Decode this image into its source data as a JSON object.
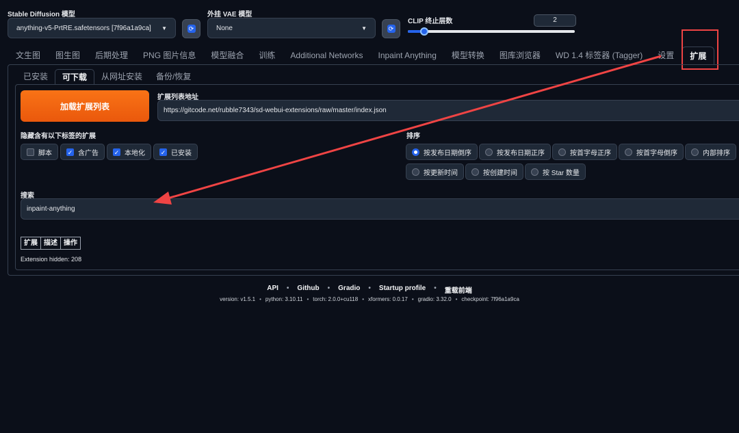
{
  "top": {
    "sd_model_label": "Stable Diffusion 模型",
    "sd_model_value": "anything-v5-PrtRE.safetensors [7f96a1a9ca]",
    "vae_label": "外挂 VAE 模型",
    "vae_value": "None",
    "clip_label": "CLIP 终止层数",
    "clip_value": "2",
    "clip_fraction": 0.1
  },
  "tabs": [
    {
      "label": "文生图"
    },
    {
      "label": "图生图"
    },
    {
      "label": "后期处理"
    },
    {
      "label": "PNG 图片信息"
    },
    {
      "label": "模型融合"
    },
    {
      "label": "训练"
    },
    {
      "label": "Additional Networks"
    },
    {
      "label": "Inpaint Anything"
    },
    {
      "label": "模型转换"
    },
    {
      "label": "图库浏览器"
    },
    {
      "label": "WD 1.4 标签器 (Tagger)"
    },
    {
      "label": "设置"
    },
    {
      "label": "扩展"
    }
  ],
  "subtabs": [
    {
      "label": "已安装"
    },
    {
      "label": "可下载"
    },
    {
      "label": "从网址安装"
    },
    {
      "label": "备份/恢复"
    }
  ],
  "available": {
    "load_button": "加载扩展列表",
    "url_label": "扩展列表地址",
    "url_value": "https://gitcode.net/rubble7343/sd-webui-extensions/raw/master/index.json",
    "hide_label": "隐藏含有以下标签的扩展",
    "hide_options": [
      {
        "label": "脚本",
        "checked": false
      },
      {
        "label": "含广告",
        "checked": true
      },
      {
        "label": "本地化",
        "checked": true
      },
      {
        "label": "已安装",
        "checked": true
      }
    ],
    "sort_label": "排序",
    "sort_options": [
      {
        "label": "按发布日期倒序",
        "selected": true
      },
      {
        "label": "按发布日期正序",
        "selected": false
      },
      {
        "label": "按首字母正序",
        "selected": false
      },
      {
        "label": "按首字母倒序",
        "selected": false
      },
      {
        "label": "内部排序",
        "selected": false
      },
      {
        "label": "按更新时间",
        "selected": false
      },
      {
        "label": "按创建时间",
        "selected": false
      },
      {
        "label": "按 Star 数量",
        "selected": false
      }
    ],
    "search_label": "搜索",
    "search_value": "inpaint-anything",
    "table_headers": [
      "扩展",
      "描述",
      "操作"
    ],
    "hidden_text": "Extension hidden: 208"
  },
  "footer": {
    "links": [
      "API",
      "Github",
      "Gradio",
      "Startup profile",
      "重载前端"
    ],
    "versions": [
      "version: v1.5.1",
      "python: 3.10.11",
      "torch: 2.0.0+cu118",
      "xformers: 0.0.17",
      "gradio: 3.32.0",
      "checkpoint: 7f96a1a9ca"
    ]
  },
  "colors": {
    "accent": "#2563eb",
    "orange": "#f97316",
    "annotation": "#ef4444"
  }
}
